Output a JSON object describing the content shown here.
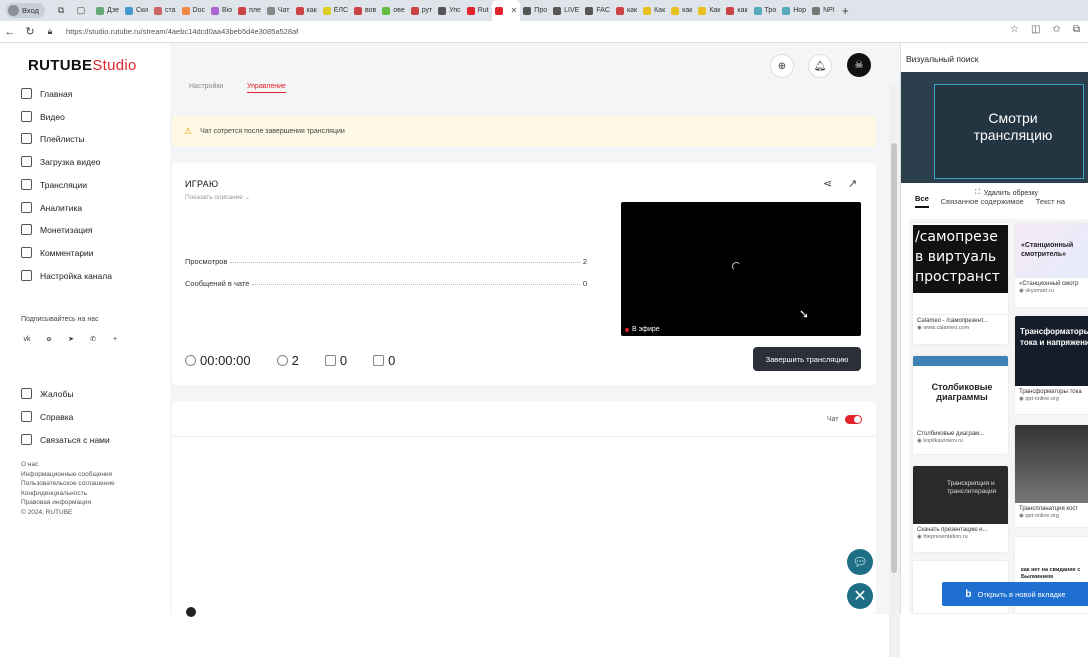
{
  "browser": {
    "profile_label": "Вход",
    "tabs": [
      {
        "label": "Дзе"
      },
      {
        "label": "Ски"
      },
      {
        "label": "ста"
      },
      {
        "label": "Doc"
      },
      {
        "label": "Bio"
      },
      {
        "label": "пле"
      },
      {
        "label": "Чат"
      },
      {
        "label": "как"
      },
      {
        "label": "ЕЛС"
      },
      {
        "label": "вов"
      },
      {
        "label": "ове"
      },
      {
        "label": "рут"
      },
      {
        "label": "Упс"
      },
      {
        "label": "Rut"
      },
      {
        "label": "",
        "active": true
      },
      {
        "label": "Про"
      },
      {
        "label": "LIVE"
      },
      {
        "label": "FAC"
      },
      {
        "label": "как"
      },
      {
        "label": "Как"
      },
      {
        "label": "как"
      },
      {
        "label": "Как"
      },
      {
        "label": "как"
      },
      {
        "label": "Тро"
      },
      {
        "label": "Нор"
      },
      {
        "label": "NPI"
      }
    ],
    "url": "https://studio.rutube.ru/stream/4aebc14dcd0aa43beb5d4e3085a528af"
  },
  "brand": {
    "logo_main": "RUTUBE",
    "logo_studio": "Studio",
    "accent": "#e0232d"
  },
  "sidebar": {
    "items": [
      {
        "label": "Главная",
        "icon": "home-icon"
      },
      {
        "label": "Видео",
        "icon": "video-icon"
      },
      {
        "label": "Плейлисты",
        "icon": "playlist-icon"
      },
      {
        "label": "Загрузка видео",
        "icon": "upload-icon"
      },
      {
        "label": "Трансляции",
        "icon": "broadcast-icon"
      },
      {
        "label": "Аналитика",
        "icon": "analytics-icon"
      },
      {
        "label": "Монетизация",
        "icon": "money-icon"
      },
      {
        "label": "Комментарии",
        "icon": "comments-icon"
      },
      {
        "label": "Настройка канала",
        "icon": "settings-icon"
      }
    ],
    "subscribe_label": "Подписывайтесь на нас",
    "social": [
      "VK",
      "OK",
      "TG",
      "VB",
      "+"
    ],
    "bottom_items": [
      {
        "label": "Жалобы",
        "icon": "flag-icon"
      },
      {
        "label": "Справка",
        "icon": "help-icon"
      },
      {
        "label": "Связаться с нами",
        "icon": "contact-icon"
      }
    ],
    "footer_links": [
      "О нас",
      "Информационные сообщения",
      "Пользовательское соглашение",
      "Конфиденциальность",
      "Правовая информация",
      "© 2024, RUTUBE"
    ]
  },
  "page_tabs": [
    "Настройки",
    "Управление"
  ],
  "notice": "Чат сотрется после завершения трансляции",
  "stream": {
    "title": "ИГРАЮ",
    "show_description": "Показать описание",
    "stats": [
      {
        "label": "Просмотров",
        "value": "2"
      },
      {
        "label": "Сообщений в чате",
        "value": "0"
      }
    ],
    "timer": "00:00:00",
    "viewers": "2",
    "likes": "0",
    "comments": "0",
    "live_label": "В эфире",
    "end_button": "Завершить трансляцию"
  },
  "chat": {
    "label": "Чат",
    "enabled": true
  },
  "visual_search": {
    "title": "Визуальный поиск",
    "preview_text": "Смотри трансляцию",
    "crop_button": "Удалить обрезку",
    "tabs": [
      "Все",
      "Связанное содержимое",
      "Текст на"
    ],
    "results": [
      {
        "img_text": "/самопрезе в виртуаль пространст",
        "caption": "Calameo - /самопрезент...",
        "source": "www.calameo.com"
      },
      {
        "img_text": "«Станционный смотритель»",
        "caption": "«Станционный смотр",
        "source": "skysmart.ru"
      },
      {
        "img_text": "Трансформаторы тока и напряжения",
        "caption": "Трансформаторы тока",
        "source": "ppt-online.org"
      },
      {
        "img_text": "Столбиковые диаграммы",
        "caption": "Столбиковые диаграм...",
        "source": "kopilkaurokov.ru"
      },
      {
        "img_text": "Транскрипция и транслитерация",
        "caption": "Скачать презентацию н...",
        "source": "thepresentation.ru"
      },
      {
        "img_text": "",
        "caption": "Транспланатция кост",
        "source": "ppt-online.org"
      },
      {
        "img_text": "как нет на свидание с Былкинием",
        "caption": "",
        "source": ""
      }
    ],
    "open_tab_button": "Открыть в новой вкладке"
  }
}
